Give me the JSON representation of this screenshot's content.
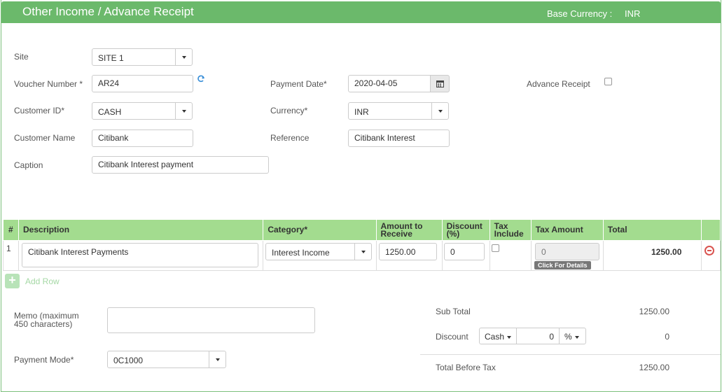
{
  "header": {
    "title": "Other Income / Advance Receipt",
    "base_currency_label": "Base Currency :",
    "base_currency_value": "INR"
  },
  "form": {
    "site": {
      "label": "Site",
      "value": "SITE 1"
    },
    "voucher_number": {
      "label": "Voucher Number *",
      "value": "AR24"
    },
    "customer_id": {
      "label": "Customer ID*",
      "value": "CASH"
    },
    "customer_name": {
      "label": "Customer Name",
      "value": "Citibank"
    },
    "caption": {
      "label": "Caption",
      "value": "Citibank Interest payment"
    },
    "payment_date": {
      "label": "Payment Date*",
      "value": "2020-04-05"
    },
    "currency": {
      "label": "Currency*",
      "value": "INR"
    },
    "reference": {
      "label": "Reference",
      "value": "Citibank Interest"
    },
    "advance_receipt": {
      "label": "Advance Receipt",
      "checked": false
    }
  },
  "grid": {
    "columns": [
      "#",
      "Description",
      "Category*",
      "Amount to Receive",
      "Discount (%)",
      "Tax Include",
      "Tax Amount",
      "Total"
    ],
    "rows": [
      {
        "index": "1",
        "description": "Citibank Interest Payments",
        "category": "Interest Income",
        "amount": "1250.00",
        "discount": "0",
        "tax_include": false,
        "tax_amount": "0",
        "details_label": "Click For Details",
        "total": "1250.00"
      }
    ],
    "add_row_label": "Add Row"
  },
  "memo": {
    "label": "Memo (maximum 450 characters)",
    "value": ""
  },
  "payment_mode": {
    "label": "Payment Mode*",
    "value": "0C1000"
  },
  "totals": {
    "sub_total_label": "Sub Total",
    "sub_total": "1250.00",
    "discount_label": "Discount",
    "discount_type": "Cash",
    "discount_input": "0",
    "discount_unit": "%",
    "discount_value": "0",
    "total_before_tax_label": "Total Before Tax",
    "total_before_tax": "1250.00"
  }
}
